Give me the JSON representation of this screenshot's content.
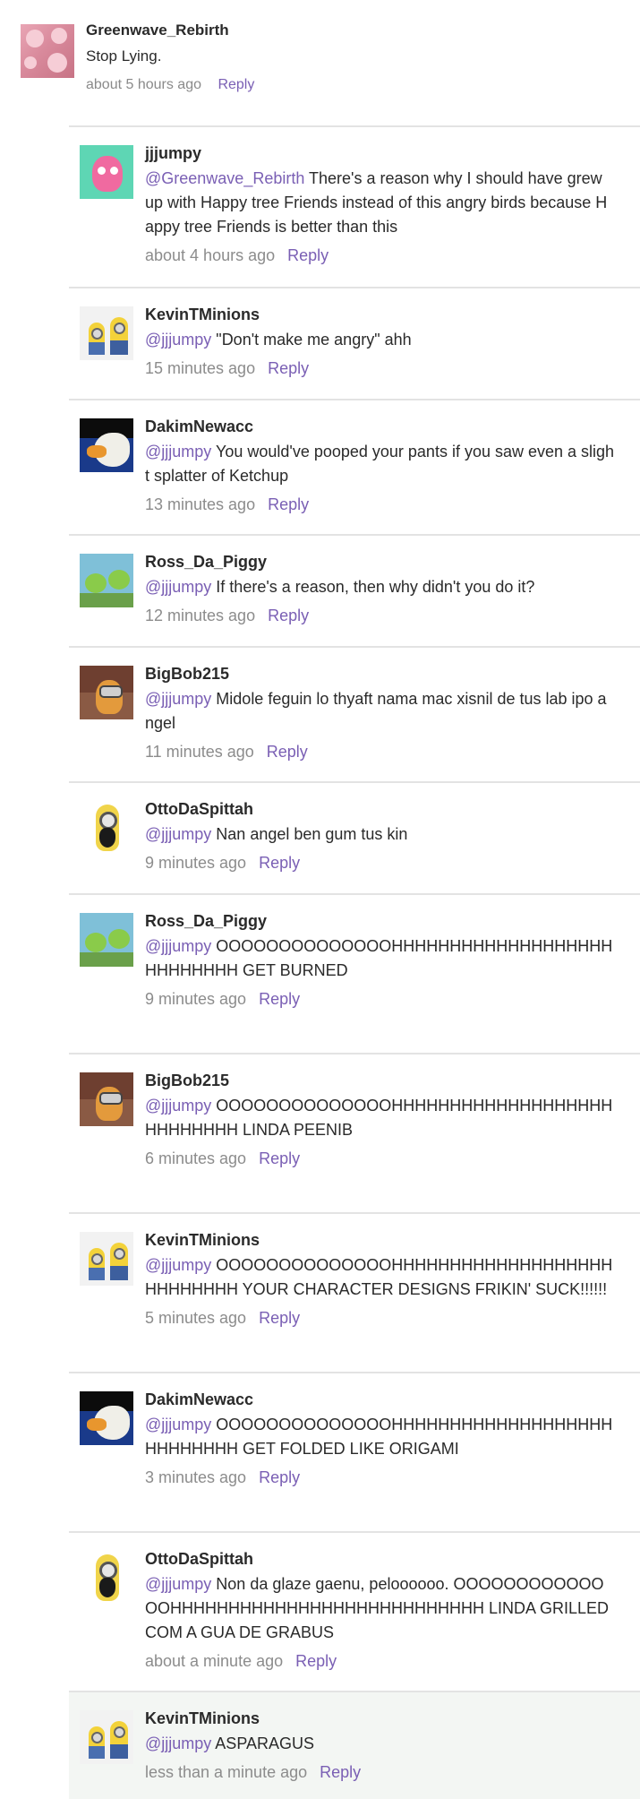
{
  "top_comment": {
    "author": "Greenwave_Rebirth",
    "text": "Stop Lying.",
    "time": "about 5 hours ago",
    "reply_label": "Reply"
  },
  "replies": [
    {
      "author": "jjjumpy",
      "mention": "@Greenwave_Rebirth",
      "text": " There's a reason why I should have grew up with Happy tree Friends instead of this angry birds because Happy tree Friends is better than this",
      "time": "about 4 hours ago",
      "reply_label": "Reply",
      "avatar": "pink-rabbit-avatar"
    },
    {
      "author": "KevinTMinions",
      "mention": "@jjjumpy",
      "text": " \"Don't make me angry\" ahh",
      "time": "15 minutes ago",
      "reply_label": "Reply",
      "avatar": "minions-avatar"
    },
    {
      "author": "DakimNewacc",
      "mention": "@jjjumpy",
      "text": " You would've pooped your pants if you saw even a slight splatter of Ketchup",
      "time": "13 minutes ago",
      "reply_label": "Reply",
      "avatar": "bird-avatar"
    },
    {
      "author": "Ross_Da_Piggy",
      "mention": "@jjjumpy",
      "text": " If there's a reason, then why didn't you do it?",
      "time": "12 minutes ago",
      "reply_label": "Reply",
      "avatar": "pigs-avatar"
    },
    {
      "author": "BigBob215",
      "mention": "@jjjumpy",
      "text": " Midole feguin lo thyaft nama mac xisnil de tus lab ipo angel",
      "time": "11 minutes ago",
      "reply_label": "Reply",
      "avatar": "bob-avatar"
    },
    {
      "author": "OttoDaSpittah",
      "mention": "@jjjumpy",
      "text": " Nan angel ben gum tus kin",
      "time": "9 minutes ago",
      "reply_label": "Reply",
      "avatar": "otto-avatar"
    },
    {
      "author": "Ross_Da_Piggy",
      "mention": "@jjjumpy",
      "text": " OOOOOOOOOOOOOOHHHHHHHHHHHHHHHHHHHHHHHHHHH GET BURNED",
      "time": "9 minutes ago",
      "reply_label": "Reply",
      "avatar": "pigs-avatar"
    },
    {
      "author": "BigBob215",
      "mention": "@jjjumpy",
      "text": " OOOOOOOOOOOOOOHHHHHHHHHHHHHHHHHHHHHHHHHHH LINDA PEENIB",
      "time": "6 minutes ago",
      "reply_label": "Reply",
      "avatar": "bob-avatar"
    },
    {
      "author": "KevinTMinions",
      "mention": "@jjjumpy",
      "text": " OOOOOOOOOOOOOOHHHHHHHHHHHHHHHHHHHHHHHHHHH YOUR CHARACTER DESIGNS FRIKIN' SUCK!!!!!!",
      "time": "5 minutes ago",
      "reply_label": "Reply",
      "avatar": "minions-avatar"
    },
    {
      "author": "DakimNewacc",
      "mention": "@jjjumpy",
      "text": " OOOOOOOOOOOOOOHHHHHHHHHHHHHHHHHHHHHHHHHHH GET FOLDED LIKE ORIGAMI",
      "time": "3 minutes ago",
      "reply_label": "Reply",
      "avatar": "bird-avatar"
    },
    {
      "author": "OttoDaSpittah",
      "mention": "@jjjumpy",
      "text": " Non da glaze gaenu, peloooooo. OOOOOOOOOOOOOOHHHHHHHHHHHHHHHHHHHHHHHHHHH LINDA GRILLED COM A GUA DE GRABUS",
      "time": "about a minute ago",
      "reply_label": "Reply",
      "avatar": "otto-avatar"
    },
    {
      "author": "KevinTMinions",
      "mention": "@jjjumpy",
      "text": " ASPARAGUS",
      "time": "less than a minute ago",
      "reply_label": "Reply",
      "avatar": "minions-avatar"
    }
  ]
}
